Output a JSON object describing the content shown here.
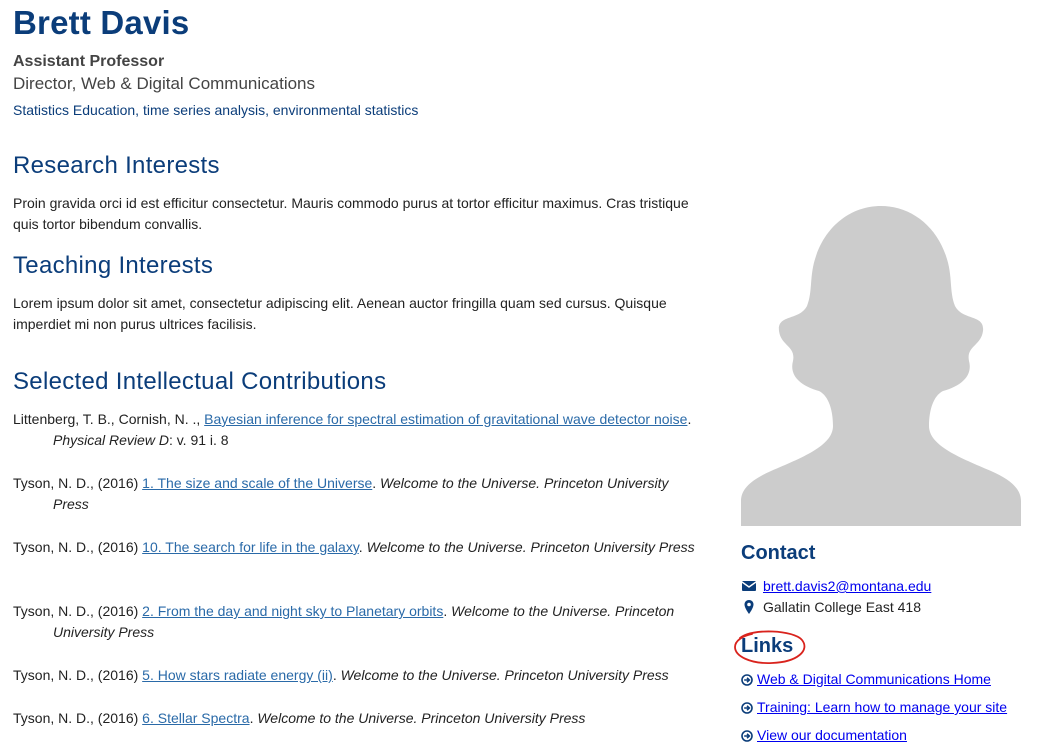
{
  "profile": {
    "name": "Brett Davis",
    "title": "Assistant Professor",
    "position": "Director, Web & Digital Communications",
    "tagline": "Statistics Education, time series analysis, environmental statistics"
  },
  "research": {
    "heading": "Research Interests",
    "text": "Proin gravida orci id est efficitur consectetur. Mauris commodo purus at tortor efficitur maximus. Cras tristique quis tortor bibendum convallis."
  },
  "teaching": {
    "heading": "Teaching Interests",
    "text": "Lorem ipsum dolor sit amet, consectetur adipiscing elit. Aenean auctor fringilla quam sed cursus. Quisque imperdiet mi non purus ultrices facilisis."
  },
  "contributions": {
    "heading": "Selected Intellectual Contributions",
    "items": [
      {
        "authors": "Littenberg, T. B., Cornish, N. ., ",
        "link": "Bayesian inference for spectral estimation of gravitational wave detector noise",
        "after_link": ". ",
        "source": "Physical Review D",
        "tail": ": v. 91 i. 8"
      },
      {
        "authors": "Tyson, N. D., (2016) ",
        "link": "1. The size and scale of the Universe",
        "after_link": ". ",
        "source": "Welcome to the Universe. Princeton University Press",
        "tail": ""
      },
      {
        "authors": "Tyson, N. D., (2016) ",
        "link": "10. The search for life in the galaxy",
        "after_link": ". ",
        "source": "Welcome to the Universe. Princeton University Press",
        "tail": ""
      },
      {
        "authors": "Tyson, N. D., (2016) ",
        "link": "2. From the day and night sky to Planetary orbits",
        "after_link": ". ",
        "source": "Welcome to the Universe. Princeton University Press",
        "tail": ""
      },
      {
        "authors": "Tyson, N. D., (2016) ",
        "link": "5. How stars radiate energy (ii)",
        "after_link": ". ",
        "source": "Welcome to the Universe. Princeton University Press",
        "tail": ""
      },
      {
        "authors": "Tyson, N. D., (2016) ",
        "link": "6. Stellar Spectra",
        "after_link": ". ",
        "source": "Welcome to the Universe. Princeton University Press",
        "tail": ""
      }
    ]
  },
  "contact": {
    "heading": "Contact",
    "email": "brett.davis2@montana.edu",
    "location": "Gallatin College East 418",
    "email_icon": "envelope-icon",
    "location_icon": "map-marker-icon"
  },
  "links": {
    "heading": "Links",
    "items": [
      "Web & Digital Communications Home",
      "Training: Learn how to manage your site",
      "View our documentation"
    ],
    "icon": "circle-arrow-right-icon"
  },
  "colors": {
    "heading": "#0b3d7a",
    "link": "#2a6aa8",
    "silhouette": "#cccccc",
    "annotation": "#d9231d"
  }
}
